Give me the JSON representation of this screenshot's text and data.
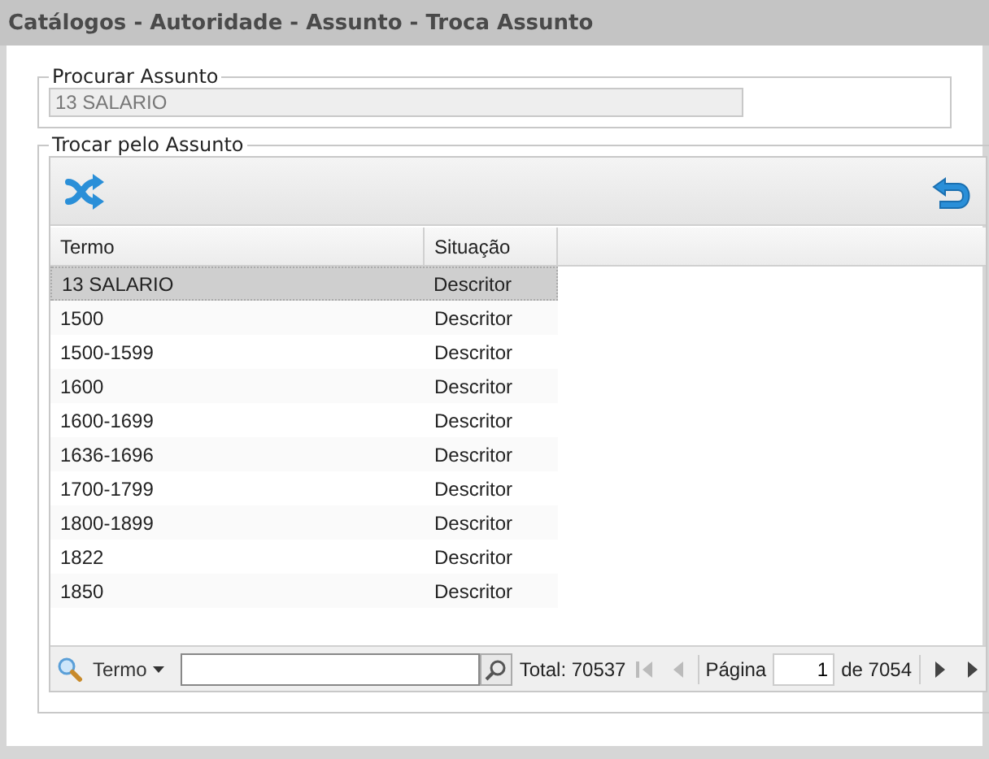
{
  "window": {
    "title": "Catálogos - Autoridade - Assunto - Troca Assunto"
  },
  "search_section": {
    "legend": "Procurar Assunto",
    "value": "13 SALARIO",
    "disabled": true
  },
  "replace_section": {
    "legend": "Trocar pelo Assunto",
    "table": {
      "columns": [
        "Termo",
        "Situação"
      ],
      "rows": [
        {
          "termo": "13 SALARIO",
          "situacao": "Descritor",
          "selected": true
        },
        {
          "termo": "1500",
          "situacao": "Descritor",
          "selected": false
        },
        {
          "termo": "1500-1599",
          "situacao": "Descritor",
          "selected": false
        },
        {
          "termo": "1600",
          "situacao": "Descritor",
          "selected": false
        },
        {
          "termo": "1600-1699",
          "situacao": "Descritor",
          "selected": false
        },
        {
          "termo": "1636-1696",
          "situacao": "Descritor",
          "selected": false
        },
        {
          "termo": "1700-1799",
          "situacao": "Descritor",
          "selected": false
        },
        {
          "termo": "1800-1899",
          "situacao": "Descritor",
          "selected": false
        },
        {
          "termo": "1822",
          "situacao": "Descritor",
          "selected": false
        },
        {
          "termo": "1850",
          "situacao": "Descritor",
          "selected": false
        }
      ]
    },
    "paging": {
      "filter_field": "Termo",
      "total": "Total: 70537",
      "page_label": "Página",
      "page": "1",
      "page_count": "de 7054"
    }
  }
}
